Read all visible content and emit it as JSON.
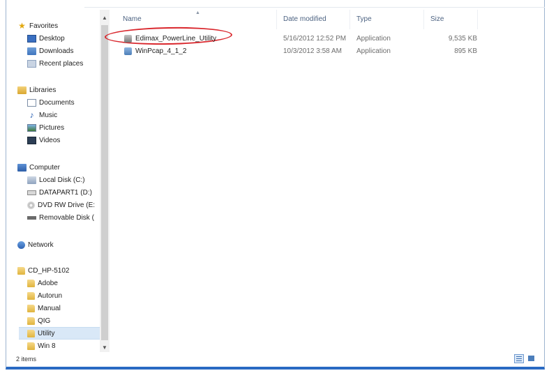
{
  "navigation": {
    "favorites": {
      "label": "Favorites",
      "items": [
        {
          "label": "Desktop",
          "icon": "desktop-icon"
        },
        {
          "label": "Downloads",
          "icon": "downloads-icon"
        },
        {
          "label": "Recent places",
          "icon": "recent-places-icon"
        }
      ]
    },
    "libraries": {
      "label": "Libraries",
      "items": [
        {
          "label": "Documents",
          "icon": "documents-icon"
        },
        {
          "label": "Music",
          "icon": "music-icon"
        },
        {
          "label": "Pictures",
          "icon": "pictures-icon"
        },
        {
          "label": "Videos",
          "icon": "videos-icon"
        }
      ]
    },
    "computer": {
      "label": "Computer",
      "items": [
        {
          "label": "Local Disk (C:)",
          "icon": "local-disk-icon"
        },
        {
          "label": "DATAPART1 (D:)",
          "icon": "drive-icon"
        },
        {
          "label": "DVD RW Drive (E:",
          "icon": "dvd-drive-icon"
        },
        {
          "label": "Removable Disk (",
          "icon": "removable-disk-icon"
        }
      ]
    },
    "network": {
      "label": "Network"
    },
    "disc": {
      "label": "CD_HP-5102",
      "items": [
        {
          "label": "Adobe"
        },
        {
          "label": "Autorun"
        },
        {
          "label": "Manual"
        },
        {
          "label": "QIG"
        },
        {
          "label": "Utility",
          "selected": true
        },
        {
          "label": "Win 8"
        }
      ]
    }
  },
  "columns": {
    "name": "Name",
    "date_modified": "Date modified",
    "type": "Type",
    "size": "Size"
  },
  "files": [
    {
      "name": "Edimax_PowerLine_Utility",
      "date_modified": "5/16/2012 12:52 PM",
      "type": "Application",
      "size": "9,535 KB",
      "highlighted": true
    },
    {
      "name": "WinPcap_4_1_2",
      "date_modified": "10/3/2012 3:58 AM",
      "type": "Application",
      "size": "895 KB",
      "highlighted": false
    }
  ],
  "status": {
    "item_count": "2 items"
  },
  "colors": {
    "accent": "#2a6ac3",
    "highlight_circle": "#d9262c",
    "selected_bg": "#d9e8f7"
  }
}
